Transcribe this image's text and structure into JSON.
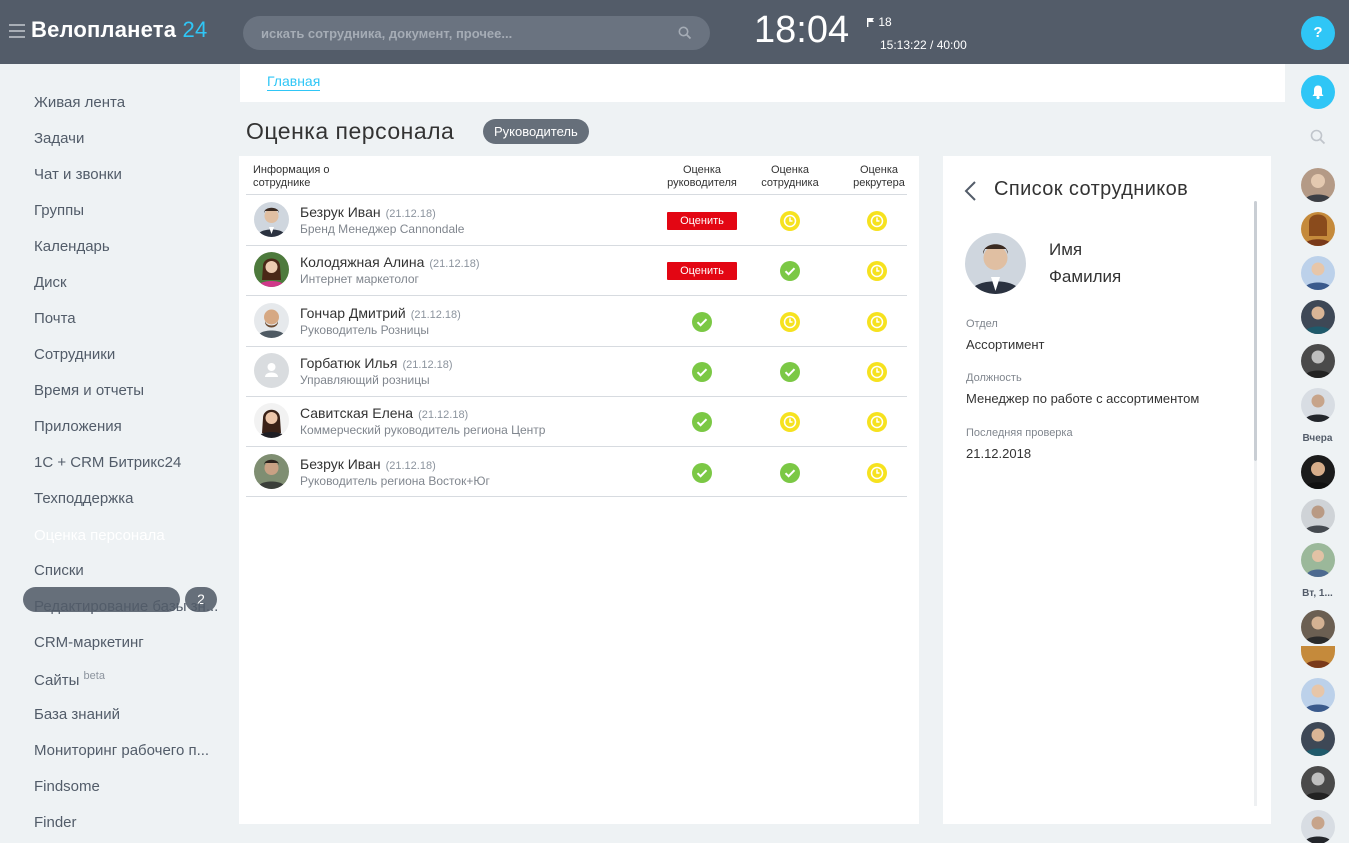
{
  "header": {
    "logo_main": "Велопланета",
    "logo_num": "24",
    "search_placeholder": "искать сотрудника, документ, прочее...",
    "clock": "18:04",
    "flag_count": "18",
    "worktime": "15:13:22 / 40:00",
    "help_label": "?"
  },
  "sidebar": {
    "items": [
      {
        "label": "Живая лента"
      },
      {
        "label": "Задачи"
      },
      {
        "label": "Чат и звонки"
      },
      {
        "label": "Группы"
      },
      {
        "label": "Календарь"
      },
      {
        "label": "Диск"
      },
      {
        "label": "Почта"
      },
      {
        "label": "Сотрудники"
      },
      {
        "label": "Время и отчеты"
      },
      {
        "label": "Приложения"
      },
      {
        "label": "1С + CRM Битрикс24"
      },
      {
        "label": "Техподдержка"
      },
      {
        "label": "Оценка персонала",
        "badge": "2"
      },
      {
        "label": "Списки"
      },
      {
        "label": "Редактирование базы зн..."
      },
      {
        "label": "CRM-маркетинг"
      },
      {
        "label": "Сайты",
        "sup": "beta"
      },
      {
        "label": "База знаний"
      },
      {
        "label": "Мониторинг рабочего п..."
      },
      {
        "label": "Findsome"
      },
      {
        "label": "Finder"
      }
    ]
  },
  "breadcrumb": {
    "home": "Главная"
  },
  "page": {
    "title": "Оценка персонала",
    "role": "Руководитель"
  },
  "table": {
    "headers": {
      "info": "Информация о сотруднике",
      "manager": "Оценка руководителя",
      "employee": "Оценка сотрудника",
      "recruiter": "Оценка рекрутера"
    },
    "rate_label": "Оценить",
    "rows": [
      {
        "name": "Безрук Иван",
        "date": "(21.12.18)",
        "position": "Бренд Менеджер Cannondale",
        "manager": "button",
        "employee": "pending",
        "recruiter": "pending"
      },
      {
        "name": "Колодяжная Алина",
        "date": "(21.12.18)",
        "position": "Интернет маркетолог",
        "manager": "button",
        "employee": "done",
        "recruiter": "pending"
      },
      {
        "name": "Гончар Дмитрий",
        "date": "(21.12.18)",
        "position": "Руководитель Розницы",
        "manager": "done",
        "employee": "pending",
        "recruiter": "pending"
      },
      {
        "name": "Горбатюк Илья",
        "date": "(21.12.18)",
        "position": "Управляющий розницы",
        "manager": "done",
        "employee": "done",
        "recruiter": "pending"
      },
      {
        "name": "Савитская Елена",
        "date": "(21.12.18)",
        "position": "Коммерческий руководитель региона Центр",
        "manager": "done",
        "employee": "pending",
        "recruiter": "pending"
      },
      {
        "name": "Безрук Иван",
        "date": "(21.12.18)",
        "position": "Руководитель региона Восток+Юг",
        "manager": "done",
        "employee": "done",
        "recruiter": "pending"
      }
    ]
  },
  "detail": {
    "title": "Список сотрудников",
    "first_name": "Имя",
    "last_name": "Фамилия",
    "dept_label": "Отдел",
    "dept_value": "Ассортимент",
    "position_label": "Должность",
    "position_value": "Менеджер по работе с ассортиментом",
    "last_check_label": "Последняя проверка",
    "last_check_value": "21.12.2018"
  },
  "right_strip": {
    "date_yesterday": "Вчера",
    "date_tue": "Вт, 1..."
  },
  "colors": {
    "header_bg": "#535c69",
    "accent": "#2fc6f6",
    "done": "#7bc845",
    "pending": "#f6e21f",
    "rate_button": "#e30613"
  }
}
